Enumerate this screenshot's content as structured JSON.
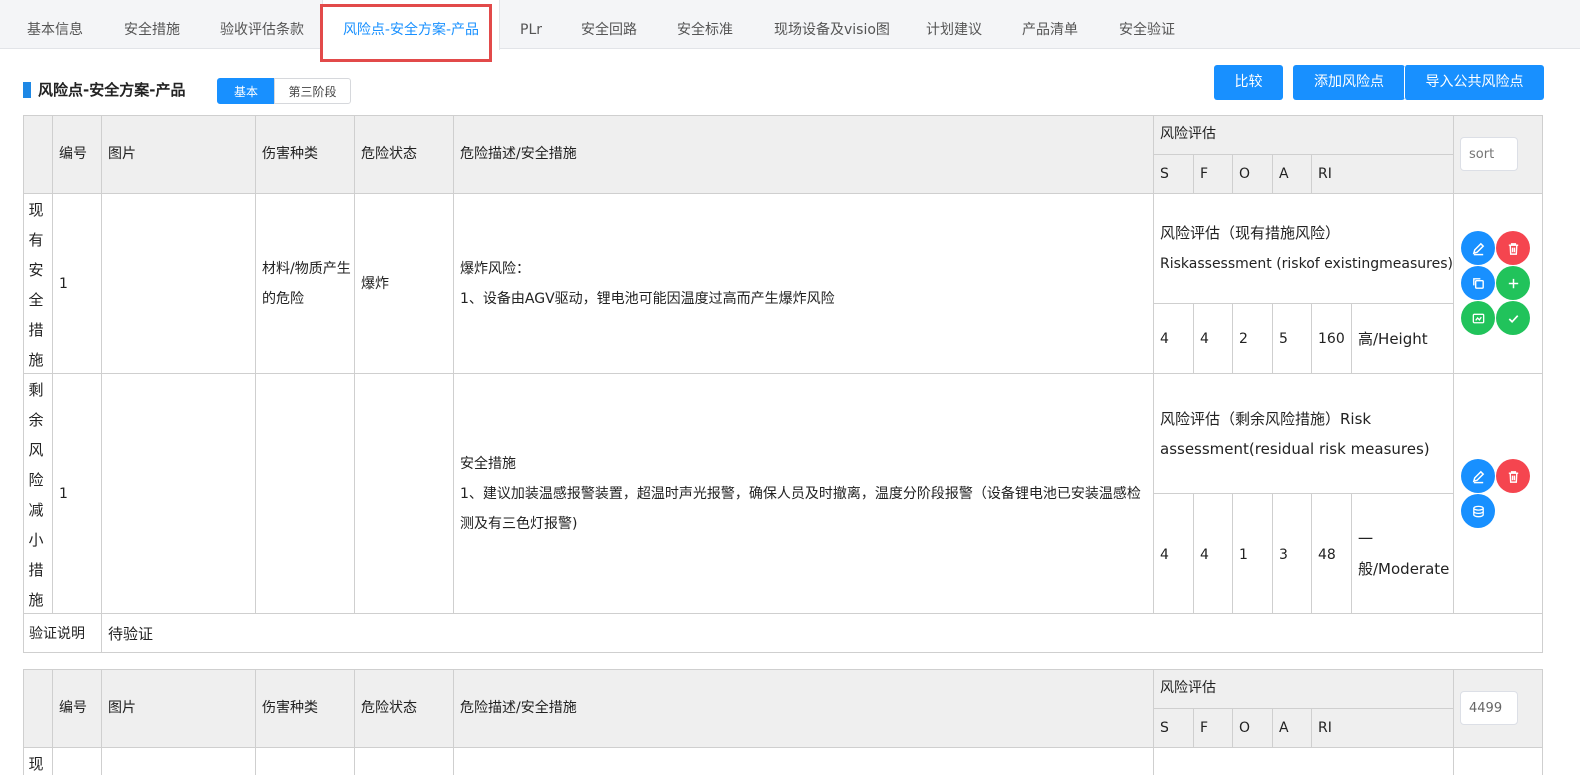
{
  "tabs": [
    {
      "label": "基本信息"
    },
    {
      "label": "安全措施"
    },
    {
      "label": "验收评估条款"
    },
    {
      "label": "风险点-安全方案-产品"
    },
    {
      "label": "PLr"
    },
    {
      "label": "安全回路"
    },
    {
      "label": "安全标准"
    },
    {
      "label": "现场设备及visio图"
    },
    {
      "label": "计划建议"
    },
    {
      "label": "产品清单"
    },
    {
      "label": "安全验证"
    }
  ],
  "active_tab": "风险点-安全方案-产品",
  "section": {
    "title": "风险点-安全方案-产品",
    "seg_basic": "基本",
    "seg_third": "第三阶段"
  },
  "actions": {
    "compare": "比较",
    "add_risk": "添加风险点",
    "import_public": "导入公共风险点"
  },
  "table_header": {
    "no": "编号",
    "image": "图片",
    "hazard_type": "伤害种类",
    "danger_state": "危险状态",
    "description": "危险描述/安全措施",
    "risk_assessment": "风险评估",
    "s": "S",
    "f": "F",
    "o": "O",
    "a": "A",
    "ri": "RI"
  },
  "card1": {
    "sort_placeholder": "sort",
    "existing": {
      "label_chars": [
        "现",
        "有",
        "安",
        "全",
        "措",
        "施"
      ],
      "no": "1",
      "hazard_type": "材料/物质产生的危险",
      "danger_state": "爆炸",
      "desc_title": "爆炸风险：",
      "desc_body": "1、设备由AGV驱动，锂电池可能因温度过高而产生爆炸风险",
      "assess_title": "风险评估（现有措施风险）",
      "assess_sub": "Riskassessment (riskof existingmeasures)",
      "s": "4",
      "f": "4",
      "o": "2",
      "a": "5",
      "ri": "160",
      "level": "高/Height"
    },
    "residual": {
      "label_chars": [
        "剩",
        "余",
        "风",
        "险",
        "减",
        "小",
        "措",
        "施"
      ],
      "no": "1",
      "desc_title": "安全措施",
      "desc_body": "1、建议加装温感报警装置，超温时声光报警，确保人员及时撤离，温度分阶段报警（设备锂电池已安装温感检测及有三色灯报警)",
      "assess_title": "风险评估（剩余风险措施）Risk assessment(residual risk measures)",
      "s": "4",
      "f": "4",
      "o": "1",
      "a": "3",
      "ri": "48",
      "level": "一般/Moderate"
    },
    "verify_label": "验证说明",
    "verify_value": "待验证"
  },
  "card2": {
    "sort_value": "4499",
    "existing_label_first": "现"
  },
  "icons": [
    "edit-icon",
    "delete-icon",
    "copy-icon",
    "plus-icon",
    "image-icon",
    "check-icon",
    "database-icon"
  ]
}
